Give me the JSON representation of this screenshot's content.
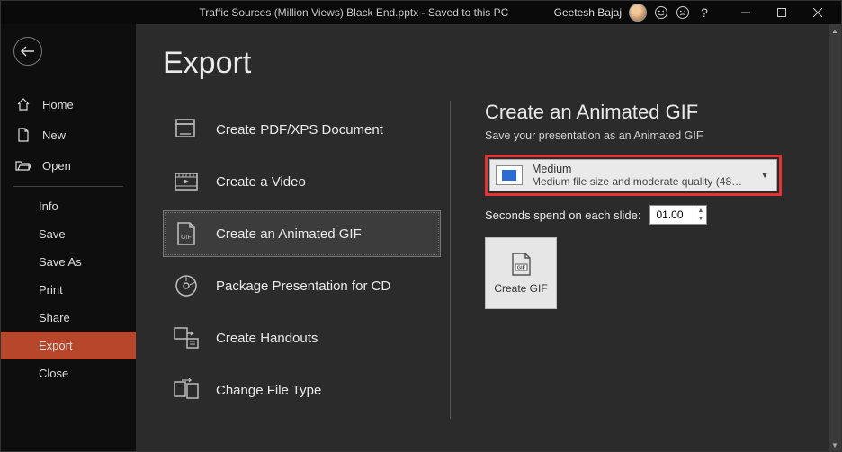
{
  "titlebar": {
    "filename": "Traffic Sources (Million Views) Black End.pptx",
    "saved_status": "Saved to this PC",
    "separator": "  -  ",
    "username": "Geetesh Bajaj"
  },
  "leftbar": {
    "home": "Home",
    "new": "New",
    "open": "Open",
    "sub": {
      "info": "Info",
      "save": "Save",
      "save_as": "Save As",
      "print": "Print",
      "share": "Share",
      "export": "Export",
      "close": "Close"
    }
  },
  "page": {
    "title": "Export"
  },
  "export_options": {
    "pdf": "Create PDF/XPS Document",
    "video": "Create a Video",
    "gif": "Create an Animated GIF",
    "package": "Package Presentation for CD",
    "handouts": "Create Handouts",
    "change_type": "Change File Type"
  },
  "right": {
    "title": "Create an Animated GIF",
    "subtitle": "Save your presentation as an Animated GIF",
    "quality": {
      "name": "Medium",
      "desc": "Medium file size and moderate quality (480p at..."
    },
    "seconds_label": "Seconds spend on each slide:",
    "seconds_value": "01.00",
    "create_label": "Create GIF",
    "gif_badge": "GIF"
  }
}
